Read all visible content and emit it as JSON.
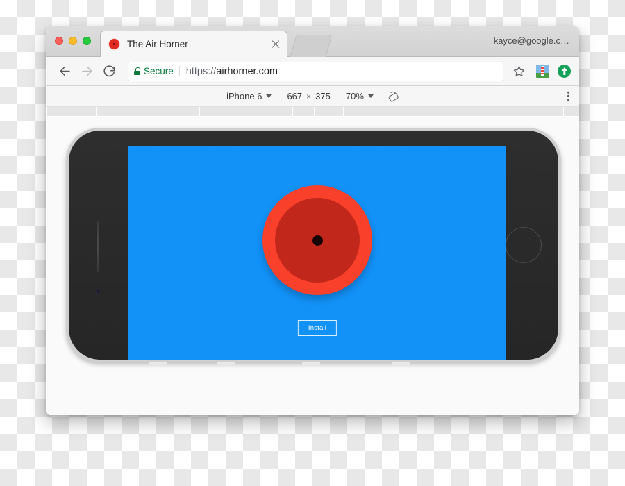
{
  "window": {
    "traffic_lights": [
      "close",
      "minimize",
      "maximize"
    ],
    "account_label": "kayce@google.c…"
  },
  "tab": {
    "title": "The Air Horner",
    "favicon": "air-horn-favicon",
    "close_label": "×"
  },
  "toolbar": {
    "back_label": "←",
    "forward_label": "→",
    "reload_label": "⟳",
    "security_label": "Secure",
    "url_scheme": "https://",
    "url_host": "airhorner.com",
    "bookmark_icon": "star-icon",
    "extensions": [
      "lighthouse-extension-icon",
      "upload-extension-icon"
    ]
  },
  "device_toolbar": {
    "device_name": "iPhone 6",
    "width": "667",
    "times": "×",
    "height": "375",
    "zoom": "70%",
    "rotate_icon": "rotate-device-icon",
    "menu_icon": "three-dot-menu-icon"
  },
  "ruler": {
    "tick_positions": [
      0,
      72,
      221,
      355,
      386,
      428,
      717,
      745,
      785,
      1105,
      1179
    ]
  },
  "device": {
    "model": "iphone-6-landscape",
    "orientation": "landscape",
    "home_button": "home-button",
    "speaker": "earpiece-speaker",
    "camera": "front-camera"
  },
  "page": {
    "background_color": "#1291f7",
    "horn": {
      "name": "air-horn-button",
      "outer_color": "#f8402a",
      "inner_color": "#c1271b",
      "dot_color": "#160404"
    },
    "install_button_label": "Install"
  }
}
